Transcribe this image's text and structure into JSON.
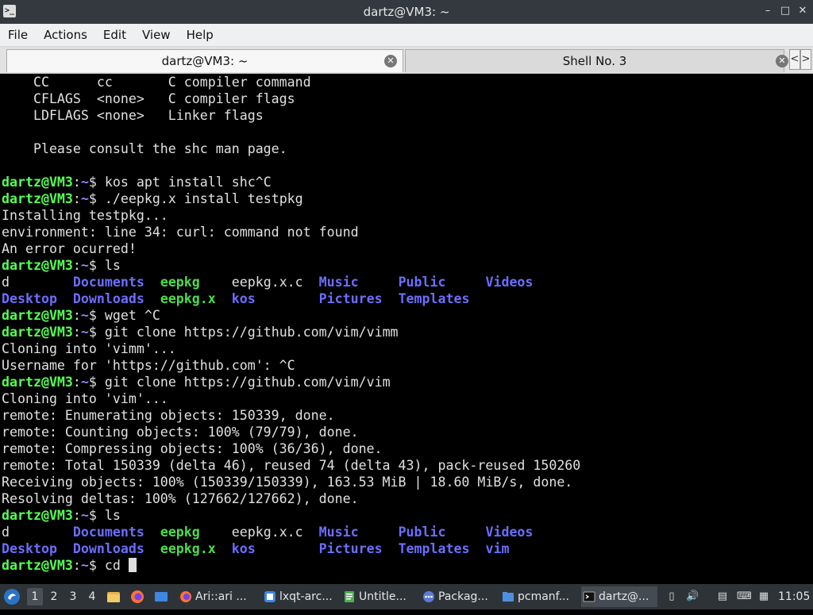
{
  "window": {
    "title": "dartz@VM3: ~",
    "app_icon": ">_",
    "buttons": {
      "minimize": "–",
      "maximize": "□",
      "close": "✕"
    }
  },
  "menu": [
    "File",
    "Actions",
    "Edit",
    "View",
    "Help"
  ],
  "tabs": [
    {
      "label": "dartz@VM3: ~",
      "close": "✕"
    },
    {
      "label": "Shell No. 3",
      "close": "✕"
    }
  ],
  "tab_scroll": {
    "left": "<",
    "right": ">"
  },
  "prompt": {
    "user": "dartz@VM3",
    "sep": ":",
    "path": "~",
    "sigil": "$ "
  },
  "terminal": {
    "help": [
      "    CC      cc       C compiler command",
      "    CFLAGS  <none>   C compiler flags",
      "    LDFLAGS <none>   Linker flags",
      "",
      "    Please consult the shc man page.",
      ""
    ],
    "cmd1": "kos apt install shc^C",
    "cmd2": "./eepkg.x install testpkg",
    "out2": [
      "Installing testpkg...",
      "environment: line 34: curl: command not found",
      "An error ocurred!"
    ],
    "cmd3": "ls",
    "ls1": [
      [
        {
          "t": "d",
          "c": "file"
        },
        {
          "t": "Documents",
          "c": "dir"
        },
        {
          "t": "eepkg",
          "c": "exe"
        },
        {
          "t": "eepkg.x.c",
          "c": "file"
        },
        {
          "t": "Music",
          "c": "dir"
        },
        {
          "t": "Public",
          "c": "dir"
        },
        {
          "t": "Videos",
          "c": "dir"
        }
      ],
      [
        {
          "t": "Desktop",
          "c": "dir"
        },
        {
          "t": "Downloads",
          "c": "dir"
        },
        {
          "t": "eepkg.x",
          "c": "exe"
        },
        {
          "t": "kos",
          "c": "dir"
        },
        {
          "t": "Pictures",
          "c": "dir"
        },
        {
          "t": "Templates",
          "c": "dir"
        }
      ]
    ],
    "cmd4": "wget ^C",
    "cmd5": "git clone https://github.com/vim/vimm",
    "out5": [
      "Cloning into 'vimm'...",
      "Username for 'https://github.com': ^C"
    ],
    "cmd6": "git clone https://github.com/vim/vim",
    "out6": [
      "Cloning into 'vim'...",
      "remote: Enumerating objects: 150339, done.",
      "remote: Counting objects: 100% (79/79), done.",
      "remote: Compressing objects: 100% (36/36), done.",
      "remote: Total 150339 (delta 46), reused 74 (delta 43), pack-reused 150260",
      "Receiving objects: 100% (150339/150339), 163.53 MiB | 18.60 MiB/s, done.",
      "Resolving deltas: 100% (127662/127662), done."
    ],
    "cmd7": "ls",
    "ls2": [
      [
        {
          "t": "d",
          "c": "file"
        },
        {
          "t": "Documents",
          "c": "dir"
        },
        {
          "t": "eepkg",
          "c": "exe"
        },
        {
          "t": "eepkg.x.c",
          "c": "file"
        },
        {
          "t": "Music",
          "c": "dir"
        },
        {
          "t": "Public",
          "c": "dir"
        },
        {
          "t": "Videos",
          "c": "dir"
        }
      ],
      [
        {
          "t": "Desktop",
          "c": "dir"
        },
        {
          "t": "Downloads",
          "c": "dir"
        },
        {
          "t": "eepkg.x",
          "c": "exe"
        },
        {
          "t": "kos",
          "c": "dir"
        },
        {
          "t": "Pictures",
          "c": "dir"
        },
        {
          "t": "Templates",
          "c": "dir"
        },
        {
          "t": "vim",
          "c": "dir"
        }
      ]
    ],
    "cmd8": "cd "
  },
  "taskbar": {
    "workspaces": [
      "1",
      "2",
      "3",
      "4"
    ],
    "tasks": [
      {
        "label": "Ari::ari ...",
        "icon": "firefox-icon",
        "color": "#ff7139"
      },
      {
        "label": "lxqt-arc...",
        "icon": "firefox-icon",
        "color": "#3f86e0"
      },
      {
        "label": "Untitle...",
        "icon": "document-icon",
        "color": "#4caf50"
      },
      {
        "label": "Packag...",
        "icon": "package-icon",
        "color": "#5c7bd6"
      },
      {
        "label": "pcmanf...",
        "icon": "folder-icon",
        "color": "#4f8fe0"
      },
      {
        "label": "dartz@...",
        "icon": "terminal-icon",
        "color": "#222222"
      }
    ],
    "clock": "11:05"
  }
}
